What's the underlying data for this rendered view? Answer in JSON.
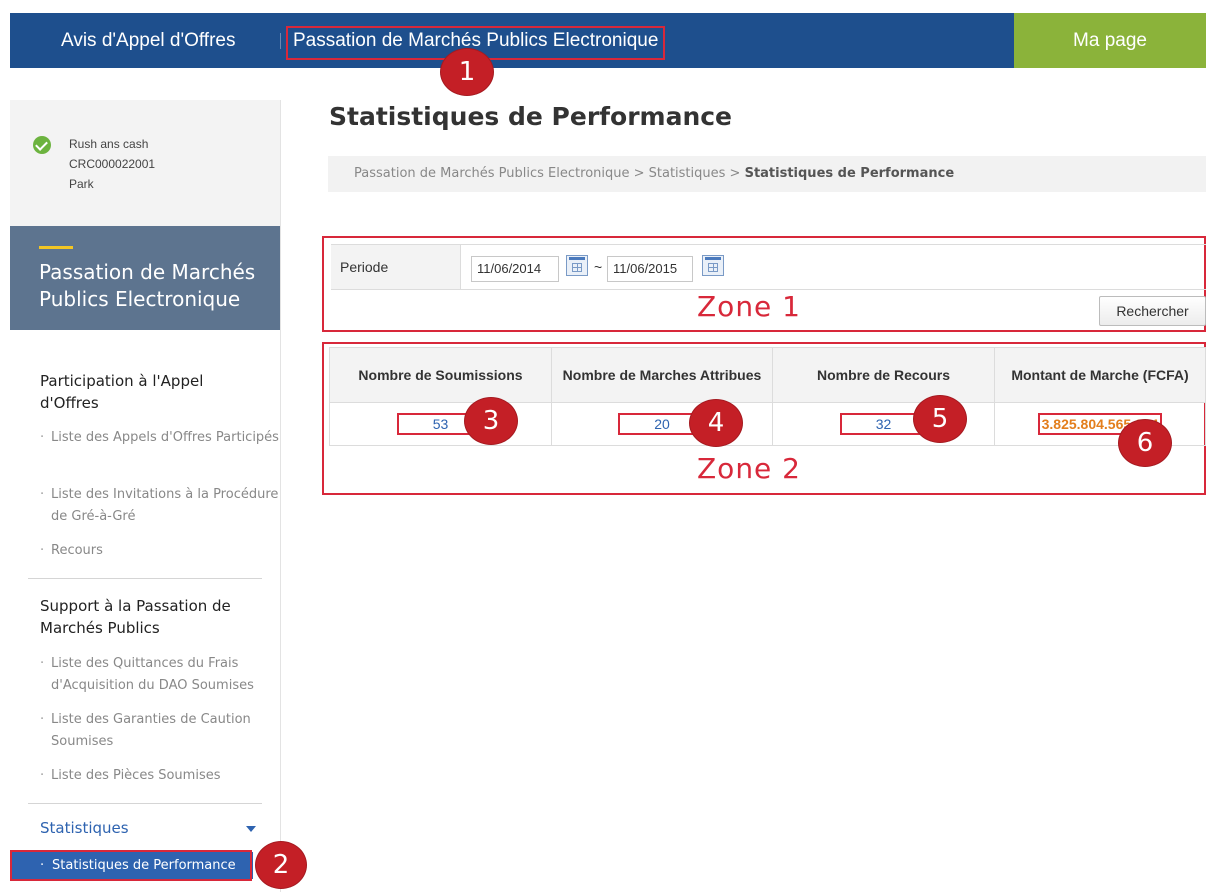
{
  "topbar": {
    "item1": "Avis d'Appel d'Offres",
    "item2": "Passation de Marchés Publics Electronique",
    "ma_page": "Ma page"
  },
  "user": {
    "name": "Rush ans cash",
    "id": "CRC000022001",
    "role": "Park"
  },
  "sidebar": {
    "section_title": "Passation de Marchés Publics Electronique",
    "group1_title": "Participation à l'Appel d'Offres",
    "group1_items": [
      "Liste des Appels d'Offres Participés",
      "Liste des Invitations à la Procédure de Gré-à-Gré",
      "Recours"
    ],
    "group2_title": "Support à la Passation de Marchés Publics",
    "group2_items": [
      "Liste des Quittances du Frais d'Acquisition du DAO Soumises",
      "Liste des Garanties de Caution Soumises",
      "Liste des Pièces Soumises"
    ],
    "group3_title": "Statistiques",
    "active_item": "Statistiques de Performance"
  },
  "main": {
    "title": "Statistiques de Performance",
    "breadcrumb_prefix": "Passation de Marchés Publics Electronique > Statistiques > ",
    "breadcrumb_current": "Statistiques de Performance"
  },
  "search": {
    "period_label": "Periode",
    "date_from": "11/06/2014",
    "date_to": "11/06/2015",
    "separator": "~",
    "button_label": "Rechercher"
  },
  "table": {
    "headers": [
      "Nombre de Soumissions",
      "Nombre de Marches Attribues",
      "Nombre de Recours",
      "Montant de Marche (FCFA)"
    ],
    "values": [
      "53",
      "20",
      "32",
      "3.825.804.565.074"
    ]
  },
  "annotations": {
    "zone1": "Zone 1",
    "zone2": "Zone 2",
    "badges": [
      "1",
      "2",
      "3",
      "4",
      "5",
      "6"
    ],
    "color": "#d8283a"
  }
}
